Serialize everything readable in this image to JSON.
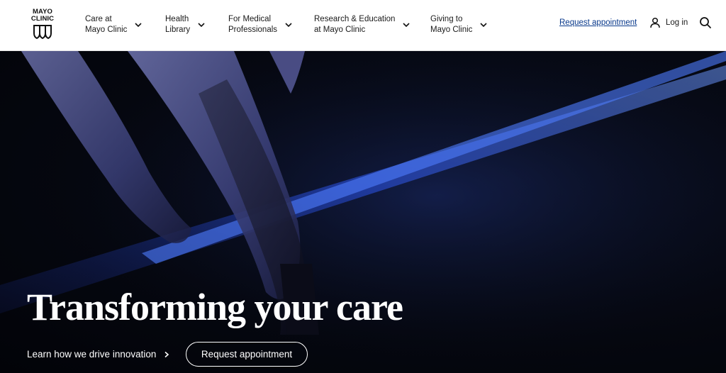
{
  "brand": {
    "logo_line1": "MAYO",
    "logo_line2": "CLINIC"
  },
  "nav": {
    "items": [
      {
        "label": "Care at\nMayo Clinic"
      },
      {
        "label": "Health\nLibrary"
      },
      {
        "label": "For Medical\nProfessionals"
      },
      {
        "label": "Research & Education\nat Mayo Clinic"
      },
      {
        "label": "Giving to\nMayo Clinic"
      }
    ],
    "request_link": "Request appointment",
    "login_label": "Log in",
    "search_icon": "search-icon",
    "user_icon": "user-icon"
  },
  "hero": {
    "title": "Transforming your care",
    "learn_link": "Learn how we drive innovation",
    "request_button": "Request appointment"
  },
  "colors": {
    "link_blue": "#0a3a8c",
    "hero_background": "#05070f",
    "light_streak": "#2f5bff"
  }
}
